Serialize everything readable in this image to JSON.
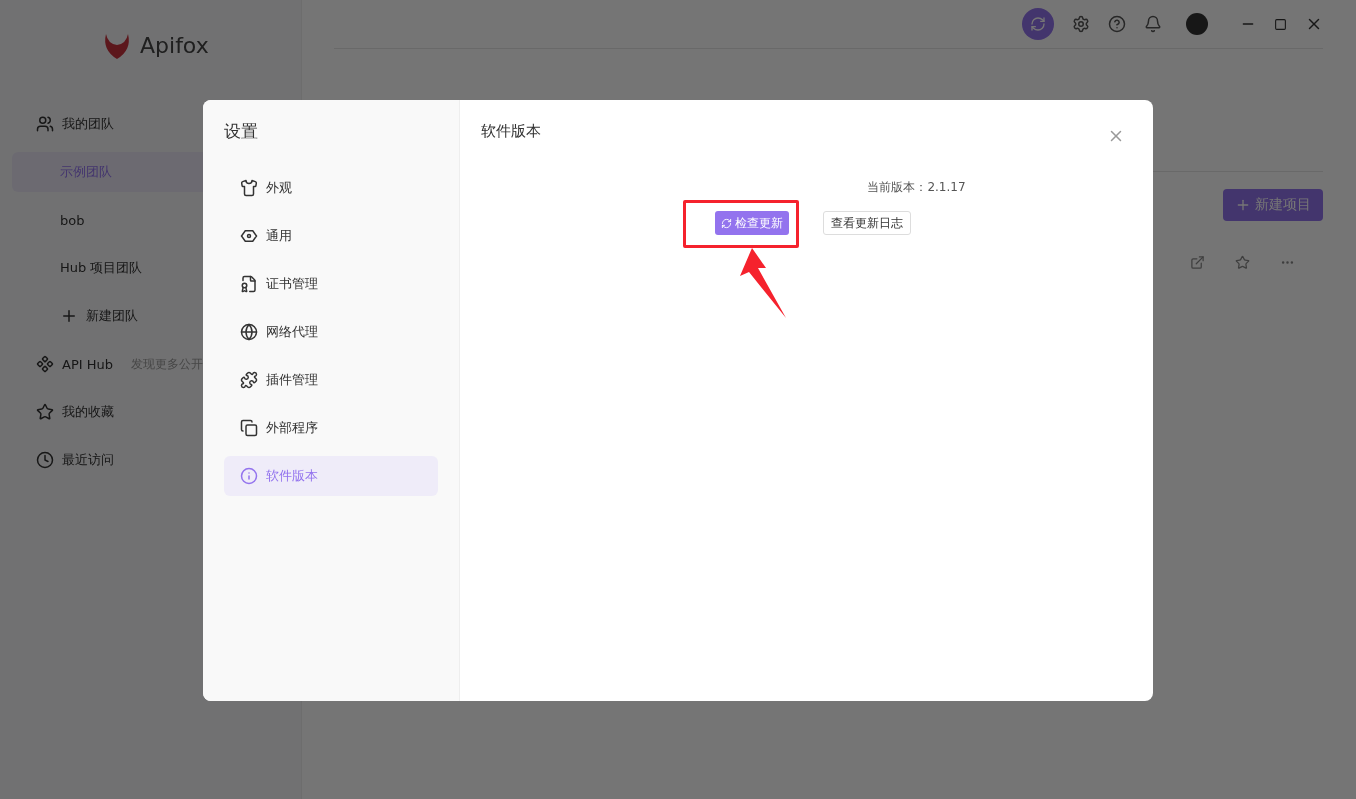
{
  "sidebar": {
    "logo": "Apifox",
    "items": [
      {
        "kind": "heading",
        "label": "我的团队"
      },
      {
        "kind": "team",
        "label": "示例团队",
        "selected": true
      },
      {
        "kind": "team",
        "label": "bob",
        "selected": false
      },
      {
        "kind": "team",
        "label": "Hub 项目团队",
        "selected": false
      },
      {
        "kind": "add",
        "label": "新建团队"
      },
      {
        "kind": "link",
        "label": "API Hub",
        "hint": "发现更多公开"
      },
      {
        "kind": "link",
        "label": "我的收藏"
      },
      {
        "kind": "link",
        "label": "最近访问"
      }
    ]
  },
  "main": {
    "new_button": "新建项目"
  },
  "dialog": {
    "title": "设置",
    "nav": [
      {
        "label": "外观",
        "selected": false
      },
      {
        "label": "通用",
        "selected": false
      },
      {
        "label": "证书管理",
        "selected": false
      },
      {
        "label": "网络代理",
        "selected": false
      },
      {
        "label": "插件管理",
        "selected": false
      },
      {
        "label": "外部程序",
        "selected": false
      },
      {
        "label": "软件版本",
        "selected": true
      }
    ],
    "section_title": "软件版本",
    "version_label": "当前版本：2.1.17",
    "check_button": "检查更新",
    "changelog_button": "查看更新日志"
  }
}
